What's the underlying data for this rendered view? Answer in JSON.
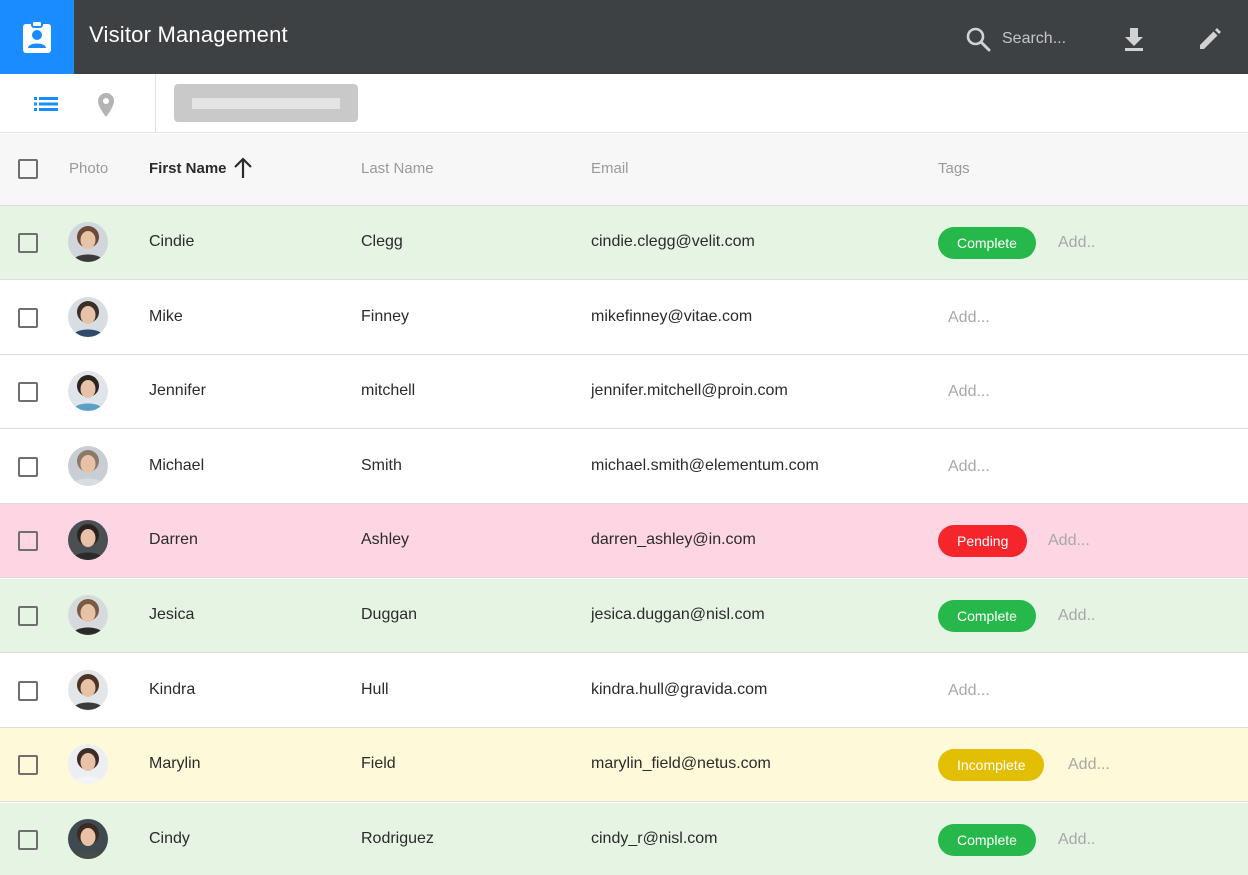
{
  "app": {
    "title": "Visitor Management",
    "icon": "badge-icon"
  },
  "header": {
    "search_placeholder": "Search...",
    "icons": [
      "search-icon",
      "download-icon",
      "edit-icon"
    ]
  },
  "toolbar": {
    "views": [
      "list-view-icon",
      "map-view-icon"
    ]
  },
  "table": {
    "columns": {
      "photo": "Photo",
      "first_name": "First Name",
      "last_name": "Last Name",
      "email": "Email",
      "tags": "Tags"
    },
    "sorted_column": "first_name",
    "sort_direction": "ascending",
    "rows": [
      {
        "first": "Cindie",
        "last": "Clegg",
        "email": "cindie.clegg@velit.com",
        "status": "complete",
        "tag": "Complete",
        "add": "Add.."
      },
      {
        "first": "Mike",
        "last": "Finney",
        "email": "mikefinney@vitae.com",
        "status": "none",
        "tag": "",
        "add": "Add..."
      },
      {
        "first": "Jennifer",
        "last": "mitchell",
        "email": "jennifer.mitchell@proin.com",
        "status": "none",
        "tag": "",
        "add": "Add..."
      },
      {
        "first": "Michael",
        "last": "Smith",
        "email": "michael.smith@elementum.com",
        "status": "none",
        "tag": "",
        "add": "Add..."
      },
      {
        "first": "Darren",
        "last": "Ashley",
        "email": "darren_ashley@in.com",
        "status": "pending",
        "tag": "Pending",
        "add": "Add..."
      },
      {
        "first": "Jesica",
        "last": "Duggan",
        "email": "jesica.duggan@nisl.com",
        "status": "complete",
        "tag": "Complete",
        "add": "Add.."
      },
      {
        "first": "Kindra",
        "last": "Hull",
        "email": "kindra.hull@gravida.com",
        "status": "none",
        "tag": "",
        "add": "Add..."
      },
      {
        "first": "Marylin",
        "last": "Field",
        "email": "marylin_field@netus.com",
        "status": "incomplete",
        "tag": "Incomplete",
        "add": "Add..."
      },
      {
        "first": "Cindy",
        "last": "Rodriguez",
        "email": "cindy_r@nisl.com",
        "status": "complete",
        "tag": "Complete",
        "add": "Add.."
      }
    ]
  },
  "colors": {
    "topbar": "#3e4144",
    "accent": "#1a8cff",
    "complete": "#27b84b",
    "pending": "#f4262c",
    "incomplete": "#e2be05",
    "complete_row": "#e6f4e4",
    "pending_row": "#fdd5e3",
    "incomplete_row": "#fef9d8"
  }
}
